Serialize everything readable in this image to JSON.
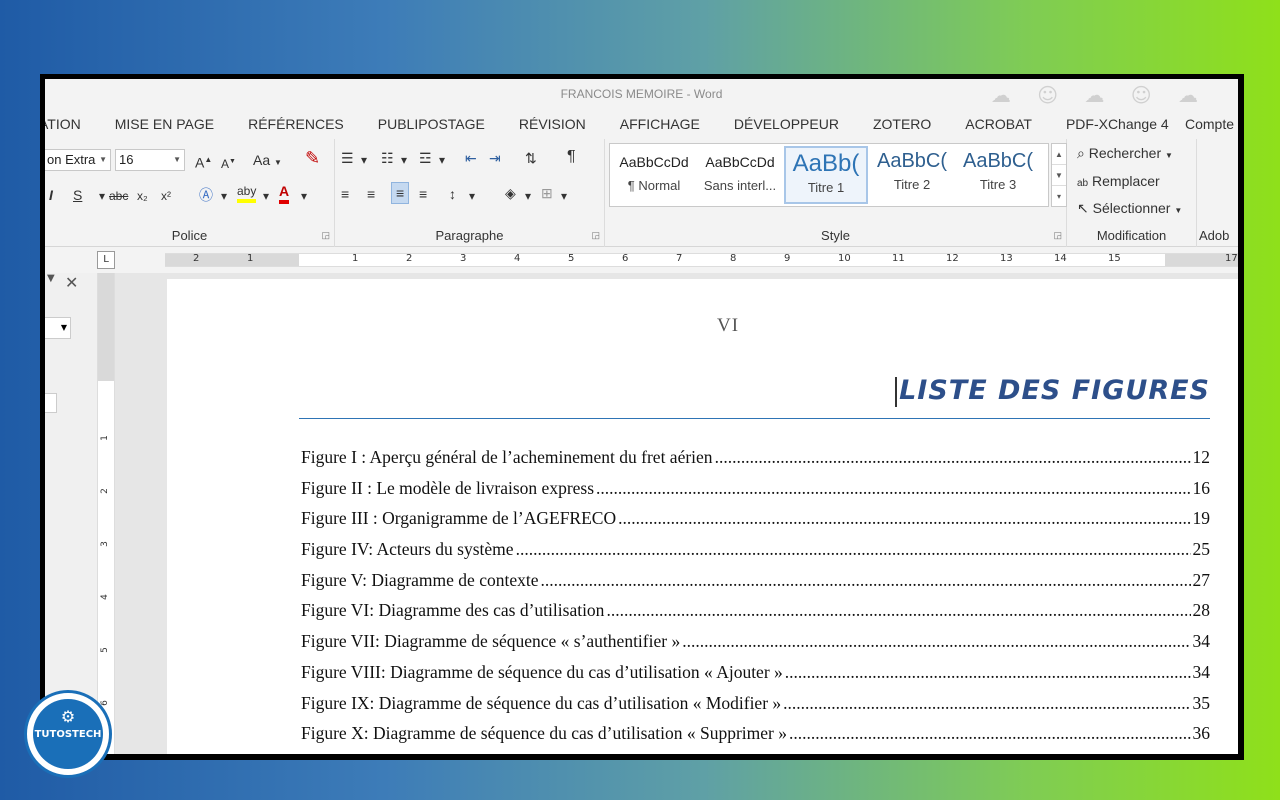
{
  "window": {
    "title": "FRANCOIS MEMOIRE - Word"
  },
  "tabs": [
    "ATION",
    "MISE EN PAGE",
    "RÉFÉRENCES",
    "PUBLIPOSTAGE",
    "RÉVISION",
    "AFFICHAGE",
    "DÉVELOPPEUR",
    "ZOTERO",
    "ACROBAT",
    "PDF-XChange 4"
  ],
  "account": "Compte",
  "ribbon": {
    "police": {
      "label": "Police",
      "font_name": "on Extra",
      "font_size": "16",
      "grow": "A",
      "shrink": "A",
      "case": "Aa",
      "italic": "I",
      "strike": "abc",
      "sub": "x₂",
      "sup": "x²",
      "s": "S",
      "highlight": "aby",
      "color": "A"
    },
    "paragraphe": {
      "label": "Paragraphe",
      "pilcrow": "¶"
    },
    "style": {
      "label": "Style",
      "items": [
        {
          "sample": "AaBbCcDd",
          "name": "¶ Normal"
        },
        {
          "sample": "AaBbCcDd",
          "name": "Sans interl..."
        },
        {
          "sample": "AaBb(",
          "name": "Titre 1"
        },
        {
          "sample": "AaBbC(",
          "name": "Titre 2"
        },
        {
          "sample": "AaBbC(",
          "name": "Titre 3"
        }
      ]
    },
    "modification": {
      "label": "Modification",
      "find": "Rechercher",
      "replace": "Remplacer",
      "select": "Sélectionner"
    },
    "adobe": {
      "label": "Adob"
    }
  },
  "ruler": {
    "left_numbers": [
      "2",
      "1"
    ],
    "numbers": [
      "1",
      "2",
      "3",
      "4",
      "5",
      "6",
      "7",
      "8",
      "9",
      "10",
      "11",
      "12",
      "13",
      "14",
      "15"
    ],
    "end": "17",
    "corner": "L"
  },
  "vruler_numbers": [
    "1",
    "2",
    "3",
    "4",
    "5",
    "6"
  ],
  "document": {
    "page_number": "VI",
    "heading": "LISTE DES FIGURES",
    "entries": [
      {
        "text": "Figure I : Aperçu général de l’acheminement du fret aérien",
        "page": "12"
      },
      {
        "text": "Figure II : Le modèle de livraison express",
        "page": "16"
      },
      {
        "text": "Figure III : Organigramme de l’AGEFRECO",
        "page": "19"
      },
      {
        "text": "Figure IV: Acteurs du système",
        "page": "25"
      },
      {
        "text": "Figure V: Diagramme de contexte",
        "page": "27"
      },
      {
        "text": "Figure VI: Diagramme des cas d’utilisation",
        "page": "28"
      },
      {
        "text": "Figure VII: Diagramme de séquence « s’authentifier »",
        "page": "34"
      },
      {
        "text": "Figure VIII: Diagramme de séquence du cas d’utilisation « Ajouter »",
        "page": "34"
      },
      {
        "text": "Figure IX: Diagramme de séquence du cas d’utilisation « Modifier »",
        "page": "35"
      },
      {
        "text": "Figure X: Diagramme de séquence du cas d’utilisation « Supprimer »",
        "page": "36"
      }
    ]
  },
  "logo": {
    "name": "TUTOSTECH"
  },
  "colors": {
    "heading": "#2d4f8a",
    "rule": "#2e74b5",
    "accent": "#1a6fb8"
  }
}
